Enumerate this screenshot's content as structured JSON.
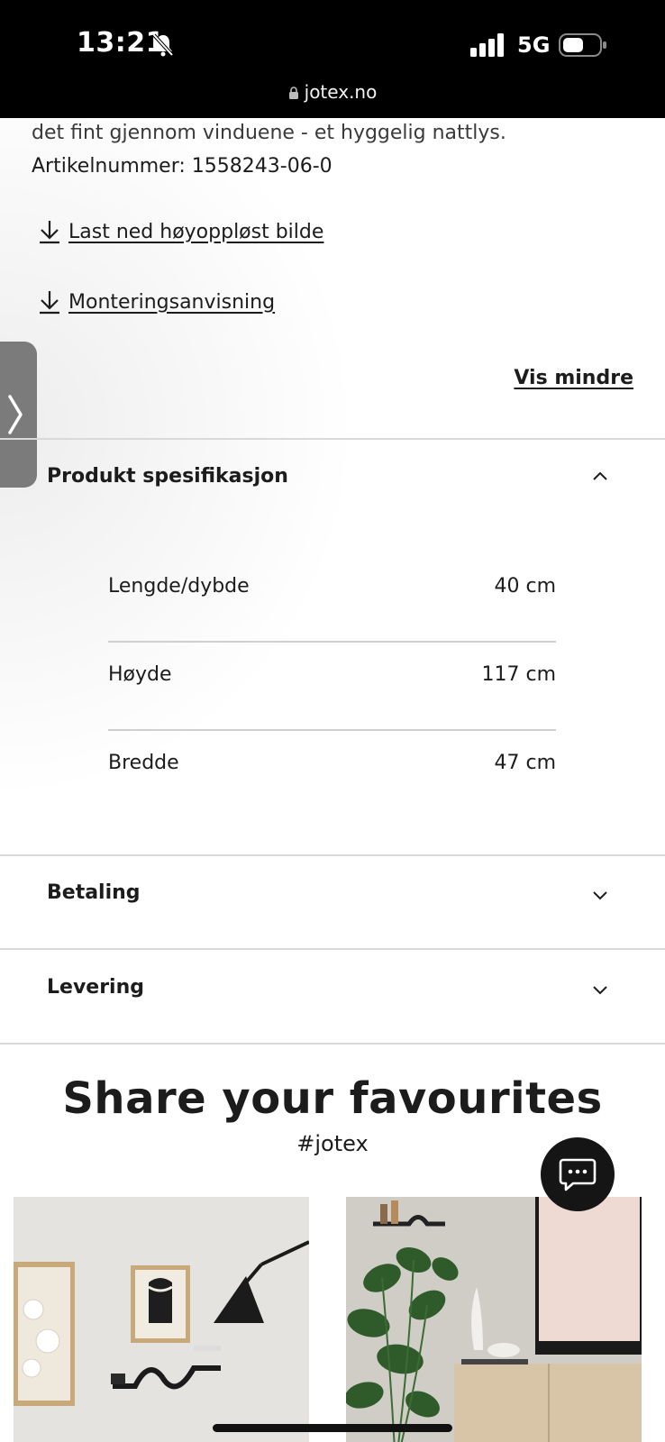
{
  "status_bar": {
    "time": "13:21",
    "network": "5G",
    "url": "jotex.no",
    "icons": [
      "bell-slash-icon",
      "signal-icon",
      "battery-icon",
      "lock-icon"
    ]
  },
  "product": {
    "description_tail": "det fint gjennom vinduene - et hyggelig nattlys.",
    "article_number": "Artikelnummer: 1558243-06-0",
    "download_image_label": "Last ned høyoppløst bilde",
    "mounting_label": "Monteringsanvisning",
    "show_less_label": "Vis mindre"
  },
  "accordion": {
    "spec_title": "Produkt spesifikasjon",
    "specs": [
      {
        "label": "Lengde/dybde",
        "value": "40 cm"
      },
      {
        "label": "Høyde",
        "value": "117 cm"
      },
      {
        "label": "Bredde",
        "value": "47 cm"
      }
    ],
    "payment_title": "Betaling",
    "delivery_title": "Levering"
  },
  "share": {
    "title": "Share your favourites",
    "hashtag": "#jotex"
  },
  "colors": {
    "status_bg": "#000000",
    "text": "#1c1c1c",
    "divider": "#d9d9d9",
    "side_tab": "#7b7b7b",
    "chat_button": "#151515"
  }
}
